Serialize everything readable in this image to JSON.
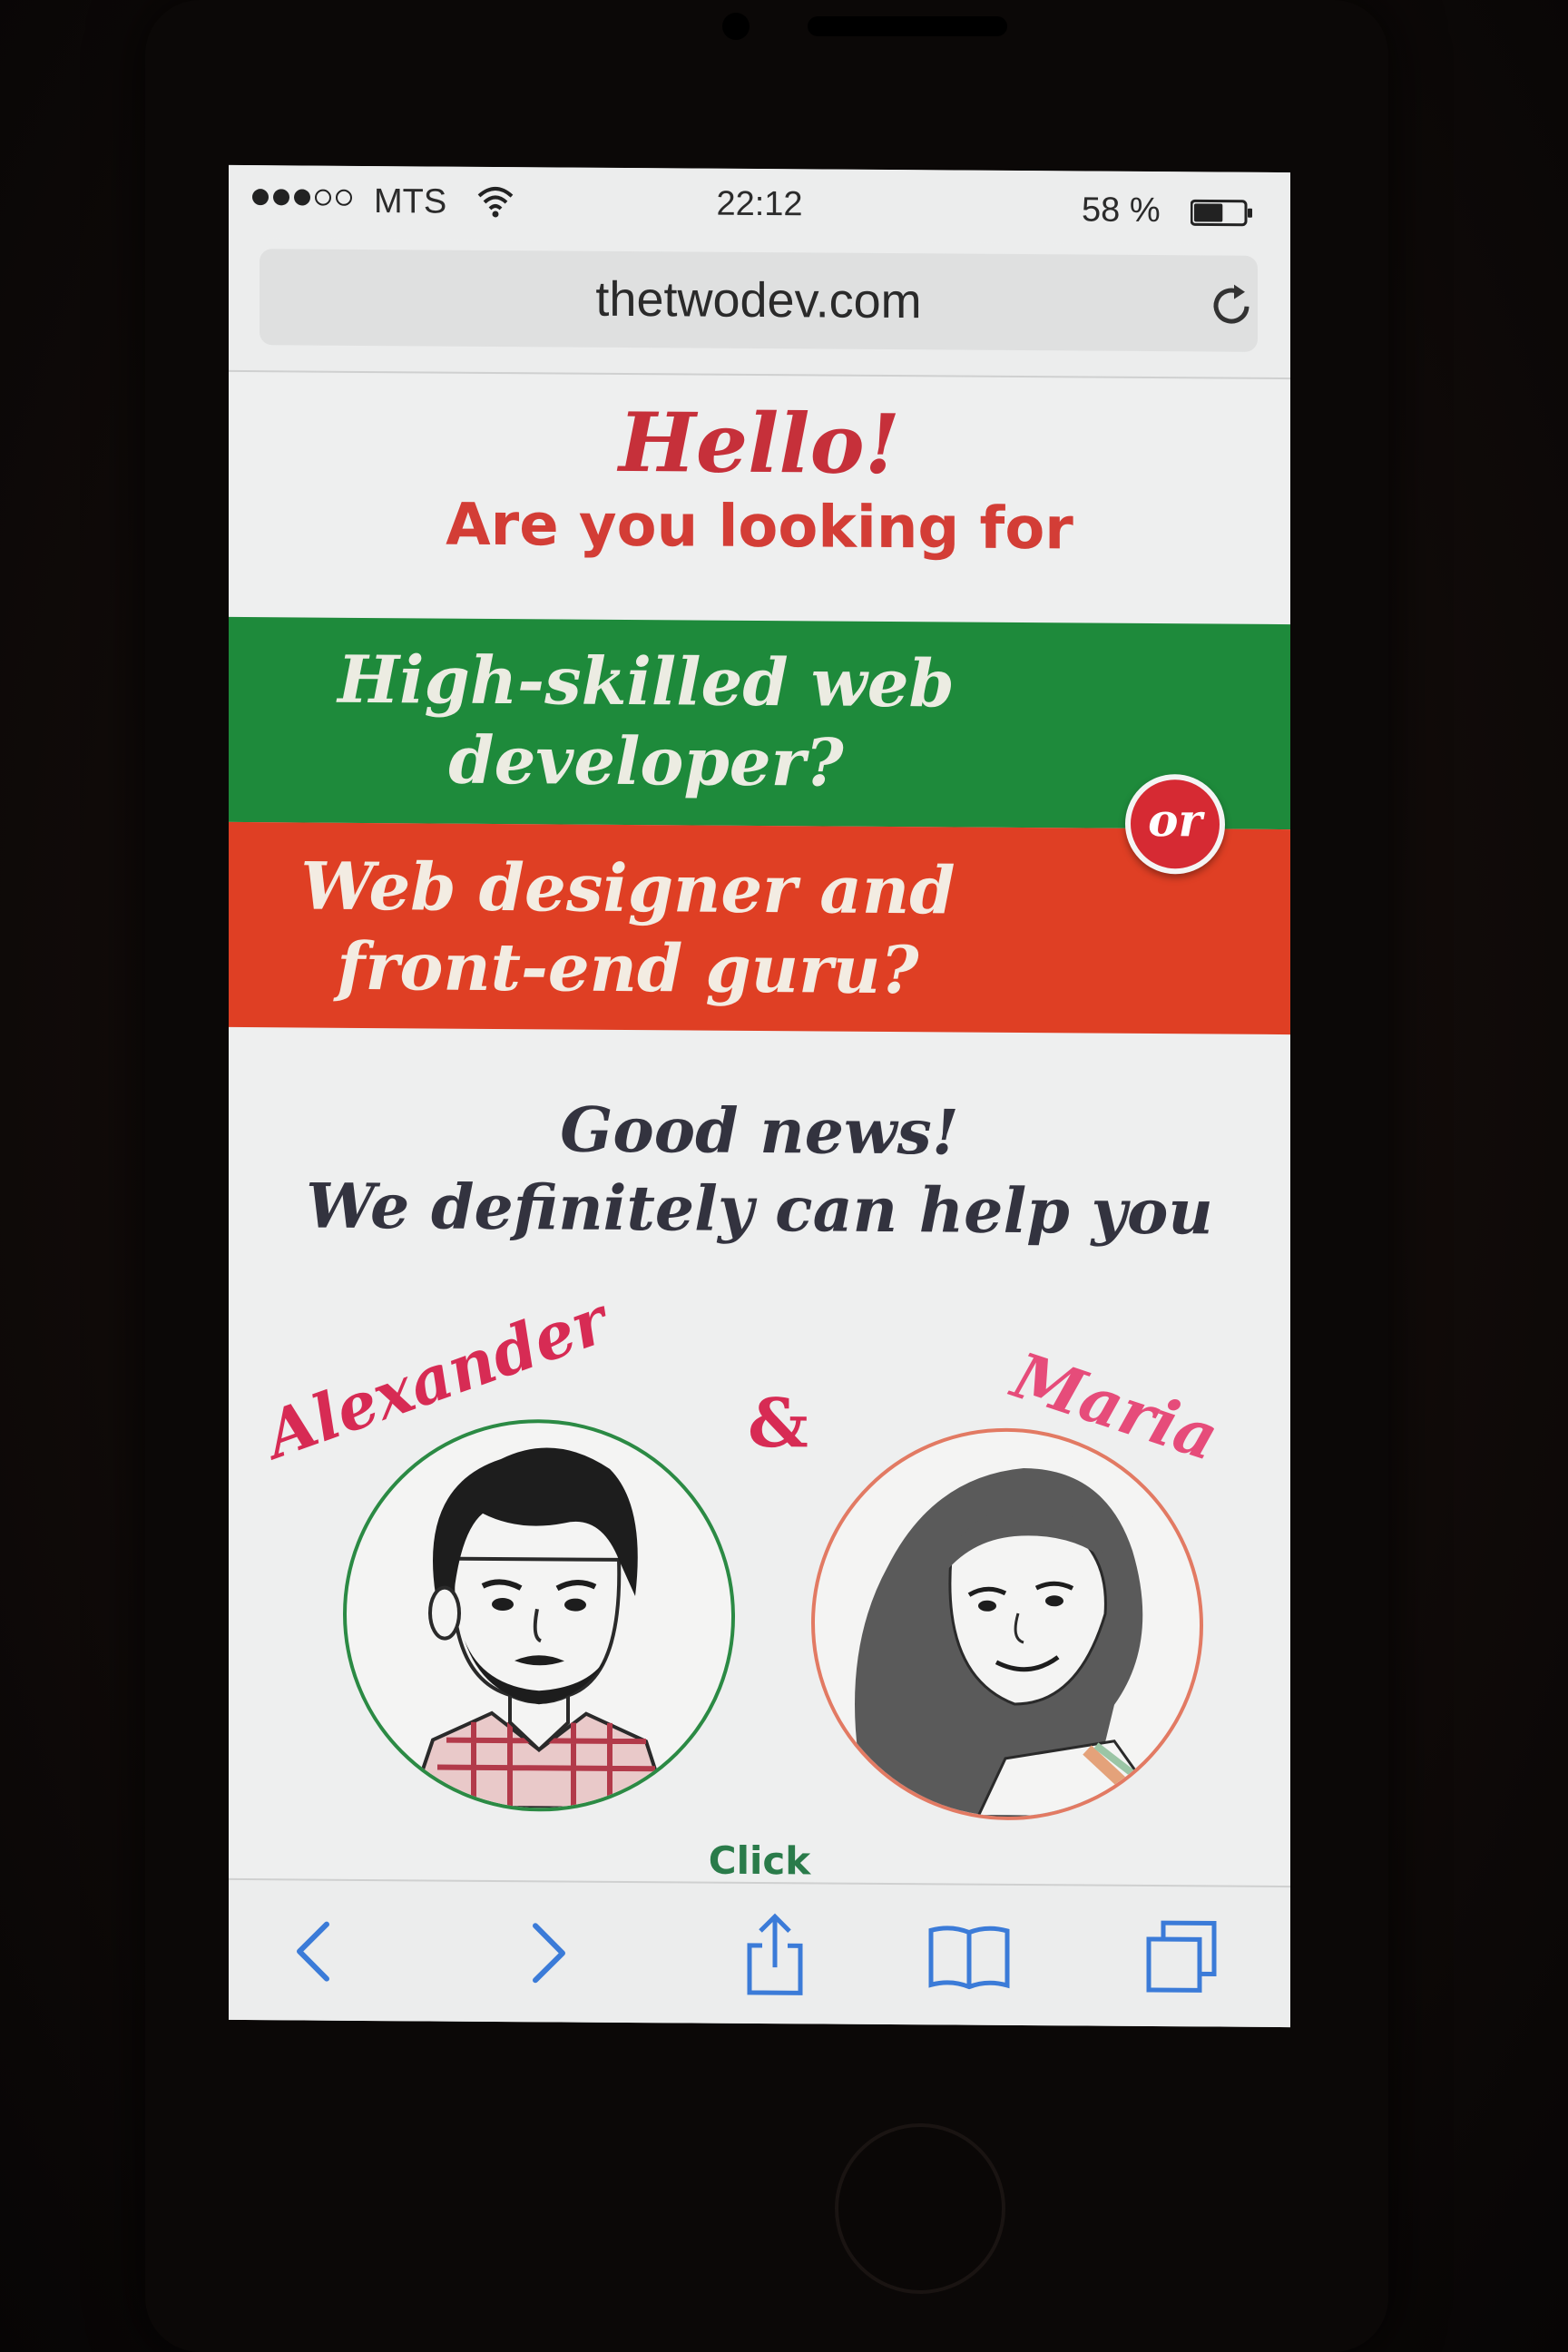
{
  "status_bar": {
    "carrier": "MTS",
    "time": "22:12",
    "battery_percent": "58 %",
    "battery_level": 0.58,
    "signal_bars_filled": 3,
    "signal_bars_total": 5
  },
  "browser": {
    "url": "thetwodev.com"
  },
  "page": {
    "greeting": "Hello!",
    "subheading": "Are you looking for",
    "option_one": "High-skilled web developer?",
    "option_two": "Web designer and front-end guru?",
    "or_badge": "or",
    "good_news_line1": "Good news!",
    "good_news_line2": "We definitely can help you",
    "person_one": "Alexander",
    "ampersand": "&",
    "person_two": "Maria",
    "click_label": "Click"
  },
  "colors": {
    "green_band": "#1e8a3b",
    "red_band": "#df3f24",
    "heading_red": "#c6303a",
    "name_pink": "#d72b54",
    "toolbar_blue": "#3b7bd8"
  },
  "icons": {
    "wifi": "wifi-icon",
    "battery": "battery-icon",
    "reload": "reload-icon",
    "back": "chevron-left-icon",
    "forward": "chevron-right-icon",
    "share": "share-icon",
    "bookmarks": "book-icon",
    "tabs": "tabs-icon"
  }
}
